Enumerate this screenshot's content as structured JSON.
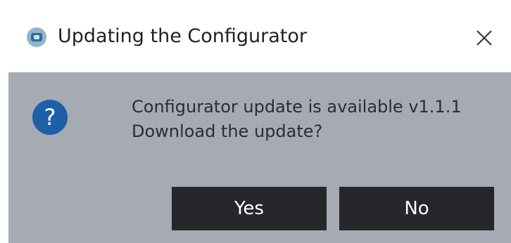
{
  "dialog": {
    "title": "Updating the Configurator",
    "app_icon": "configurator-app-icon",
    "close_icon": "close-icon",
    "question_icon": "question-icon",
    "question_glyph": "?",
    "message_line1": "Configurator update is available v1.1.1",
    "message_line2": "Download the update?",
    "yes_label": "Yes",
    "no_label": "No"
  },
  "colors": {
    "titlebar_bg": "#ffffff",
    "body_bg": "#a6aab3",
    "button_bg": "#25272b",
    "icon_blue": "#1f5fa8"
  }
}
